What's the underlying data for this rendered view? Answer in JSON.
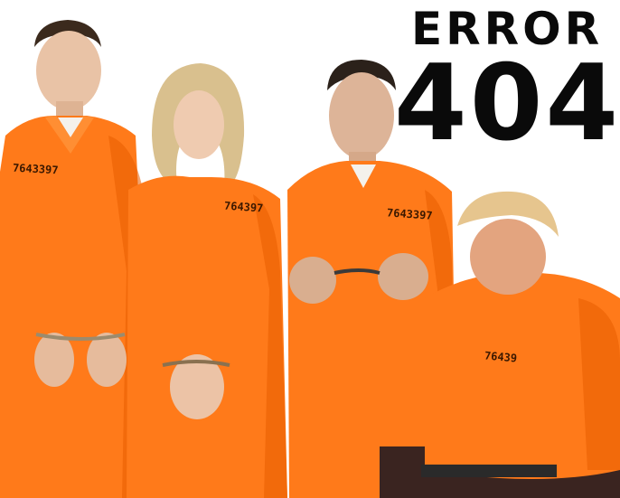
{
  "headline": {
    "error_word": "ERROR",
    "error_code": "404"
  },
  "figures": [
    {
      "id": "figure-left-man",
      "badge": "7643397"
    },
    {
      "id": "figure-woman",
      "badge": "764397"
    },
    {
      "id": "figure-center-man",
      "badge": "7643397"
    },
    {
      "id": "figure-seated-man",
      "badge": "76439"
    }
  ],
  "colors": {
    "jumpsuit": "#ff7a1a",
    "jumpsuit_shadow": "#e85d00",
    "background": "#ffffff",
    "headline": "#0a0a0a"
  }
}
